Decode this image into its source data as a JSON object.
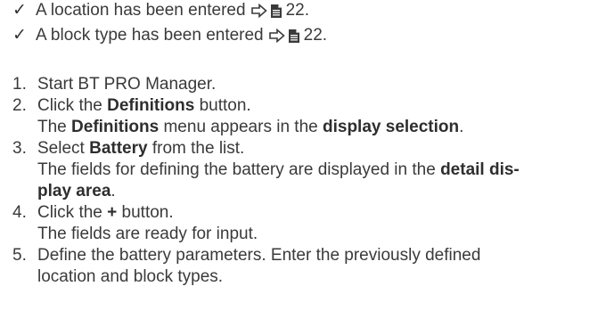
{
  "prerequisites": [
    {
      "check": "✓",
      "text": "A location has been entered",
      "ref_page": "22."
    },
    {
      "check": "✓",
      "text": "A block type has been entered",
      "ref_page": "22."
    }
  ],
  "steps": [
    {
      "number": "1.",
      "text": "Start BT PRO Manager."
    },
    {
      "number": "2.",
      "pre": "Click the ",
      "bold": "Definitions",
      "post": " button.",
      "result_pre": "The ",
      "result_bold1": "Definitions",
      "result_mid": " menu appears in the ",
      "result_bold2": "display selection",
      "result_post": "."
    },
    {
      "number": "3.",
      "pre": "Select ",
      "bold": "Battery",
      "post": " from the list.",
      "result_pre": "The fields for defining the battery are displayed in the ",
      "result_bold1": "detail dis-",
      "result_bold2": "play area",
      "result_post": "."
    },
    {
      "number": "4.",
      "pre": "Click the ",
      "bold": "+",
      "post": " button.",
      "result": "The fields are ready for input."
    },
    {
      "number": "5.",
      "line1": "Define the battery parameters. Enter the previously defined",
      "line2": "location and block types."
    }
  ]
}
